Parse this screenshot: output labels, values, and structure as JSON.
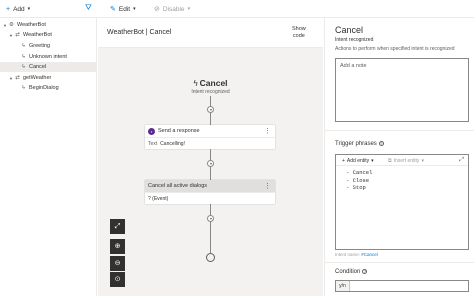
{
  "toolbar": {
    "add_label": "Add",
    "edit_label": "Edit",
    "disable_label": "Disable"
  },
  "tree": {
    "items": [
      {
        "label": "WeatherBot",
        "level": 0,
        "expanded": true,
        "icon": "gear-icon"
      },
      {
        "label": "WeatherBot",
        "level": 1,
        "expanded": true,
        "icon": "dialog-icon"
      },
      {
        "label": "Greeting",
        "level": 2,
        "icon": "bolt-icon"
      },
      {
        "label": "Unknown intent",
        "level": 2,
        "icon": "bolt-icon"
      },
      {
        "label": "Cancel",
        "level": 2,
        "icon": "bolt-icon",
        "selected": true
      },
      {
        "label": "getWeather",
        "level": 1,
        "expanded": true,
        "icon": "dialog-icon"
      },
      {
        "label": "BeginDialog",
        "level": 2,
        "icon": "bolt-icon"
      }
    ]
  },
  "canvas": {
    "breadcrumb": "WeatherBot  |  Cancel",
    "show_code_line1": "Show",
    "show_code_line2": "code",
    "trigger_title": "Cancel",
    "trigger_subtitle": "Intent recognized",
    "card1": {
      "title": "Send a response",
      "badge": "r",
      "body_label": "Text",
      "body_value": "Cancelling!"
    },
    "card2": {
      "title": "Cancel all active dialogs",
      "body_value": "? (Event)"
    }
  },
  "panel": {
    "title": "Cancel",
    "subtitle": "Intent recognized",
    "description": "Actions to perform when specified intent is recognized",
    "note_placeholder": "Add a note",
    "trigger_phrases_label": "Trigger phrases",
    "add_entity_label": "Add entity",
    "insert_entity_label": "Insert entity",
    "phrases_text": "- Cancel\n- Close\n- Stop",
    "intent_name_label": "Intent name:",
    "intent_name_value": "#Cancel",
    "condition_label": "Condition",
    "condition_prefix": "y/n"
  },
  "colors": {
    "accent": "#0078d4",
    "selected_row": "#edebe9",
    "canvas_bg": "#f3f2f1",
    "response_badge": "#5c2d91"
  }
}
